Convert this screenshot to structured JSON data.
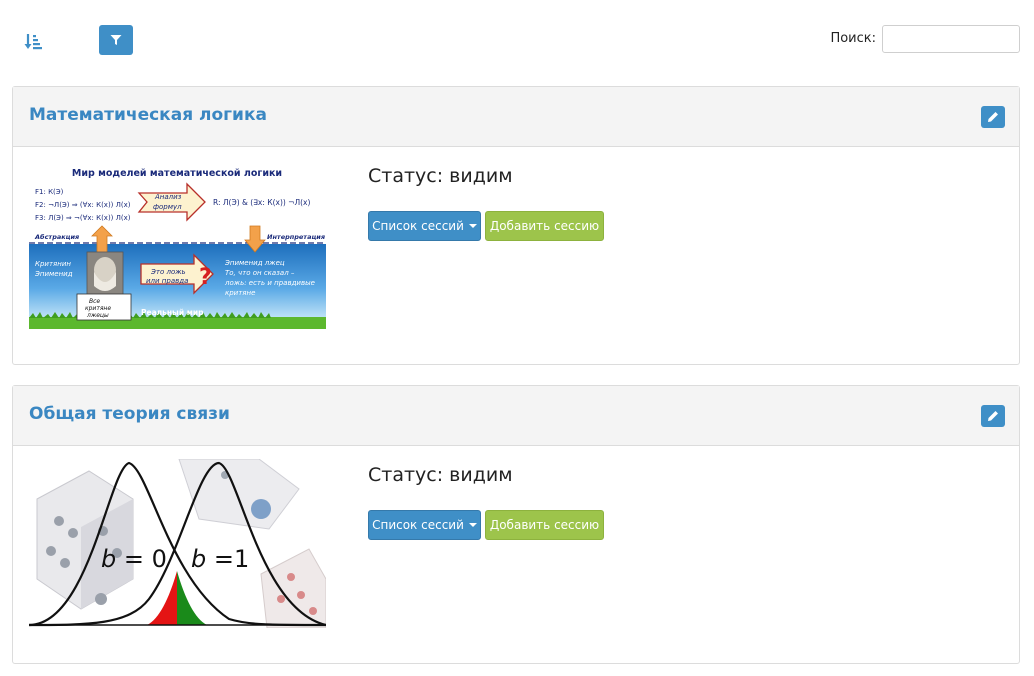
{
  "toolbar": {
    "sort_icon": "sort-amount-down-icon",
    "filter_icon": "filter-icon",
    "search_label": "Поиск:",
    "search_value": ""
  },
  "courses": [
    {
      "title": "Математическая логика",
      "status": "Статус: видим",
      "sessions_button": "Список сессий",
      "add_session_button": "Добавить сессию",
      "image": {
        "heading": "Мир моделей математической логики",
        "formula_f1": "F1: К(Э)",
        "formula_f2": "F2: ¬Л(Э) ⇒ (∀x: К(x)) Л(x)",
        "formula_f3": "F3: Л(Э) ⇒ ¬(∀x: К(x)) Л(x)",
        "analysis_label_1": "Анализ",
        "analysis_label_2": "формул",
        "result_formula": "R: Л(Э) & (∃x: К(x)) ¬Л(x)",
        "abstraction": "Абстракция",
        "interpretation": "Интерпретация",
        "cretan_1": "Критянин",
        "cretan_2": "Эпименид",
        "question_1": "Это ложь",
        "question_2": "или правда",
        "liar_1": "Эпименид лжец",
        "liar_2": "То, что он сказал –",
        "liar_3": "ложь: есть и правдивые",
        "liar_4": "критяне",
        "sign_1": "Все",
        "sign_2": "критяне",
        "sign_3": "лжецы",
        "real_world": "Реальный мир"
      }
    },
    {
      "title": "Общая теория связи",
      "status": "Статус: видим",
      "sessions_button": "Список сессий",
      "add_session_button": "Добавить сессию",
      "image": {
        "label_b0_var": "b",
        "label_b0_rest": " = 0",
        "label_b1_var": "b",
        "label_b1_rest": " =1"
      }
    }
  ],
  "colors": {
    "accent_blue": "#3f8fc7",
    "title_blue": "#3a87c2",
    "add_green": "#9dc44b"
  }
}
